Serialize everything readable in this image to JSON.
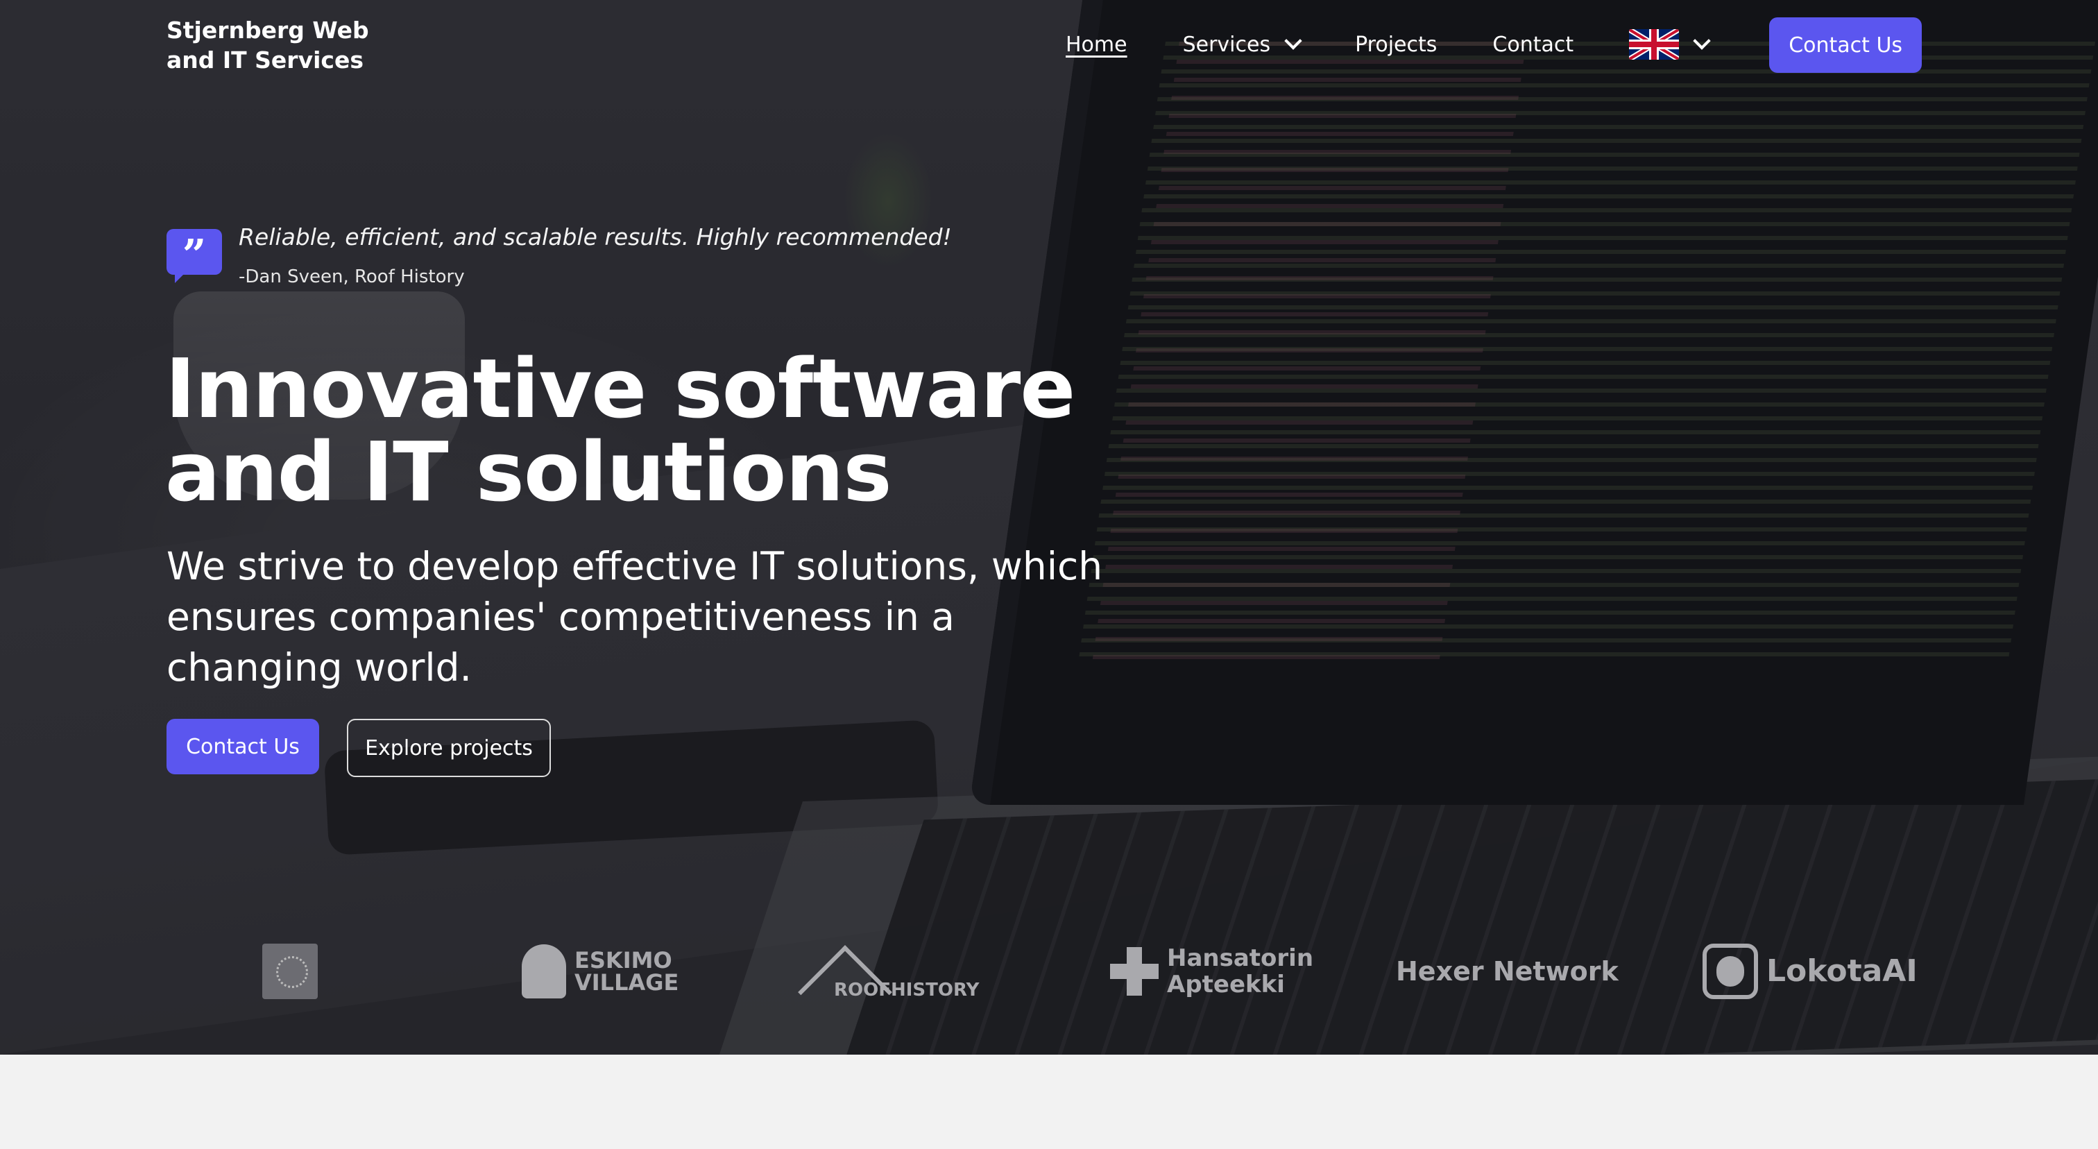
{
  "header": {
    "brand": "Stjernberg Web and IT Services",
    "nav": [
      {
        "label": "Home"
      },
      {
        "label": "Services"
      },
      {
        "label": "Projects"
      },
      {
        "label": "Contact"
      }
    ],
    "language_icon": "uk-flag-icon",
    "cta_label": "Contact Us"
  },
  "testimonial": {
    "icon": "quote-icon",
    "text": "Reliable, efficient, and scalable results. Highly recommended!",
    "author": "-Dan Sveen, Roof History"
  },
  "hero": {
    "title": "Innovative software and IT solutions",
    "subtitle": "We strive to develop effective IT solutions, which ensures companies' competitiveness in a changing world.",
    "primary_cta": "Contact Us",
    "secondary_cta": "Explore projects"
  },
  "logos": [
    {
      "name": "ESKIMO VILLAGE",
      "icon": "astronaut-icon"
    },
    {
      "name": "ROOFHISTORY",
      "icon": "roof-icon"
    },
    {
      "name": "Hansatorin Apteekki",
      "icon": "cross-icon"
    },
    {
      "name": "Hexer Network"
    },
    {
      "name": "LokotaAI",
      "icon": "lokota-icon"
    }
  ],
  "colors": {
    "accent": "#5b56ef",
    "background_below": "#f2f2f2"
  }
}
